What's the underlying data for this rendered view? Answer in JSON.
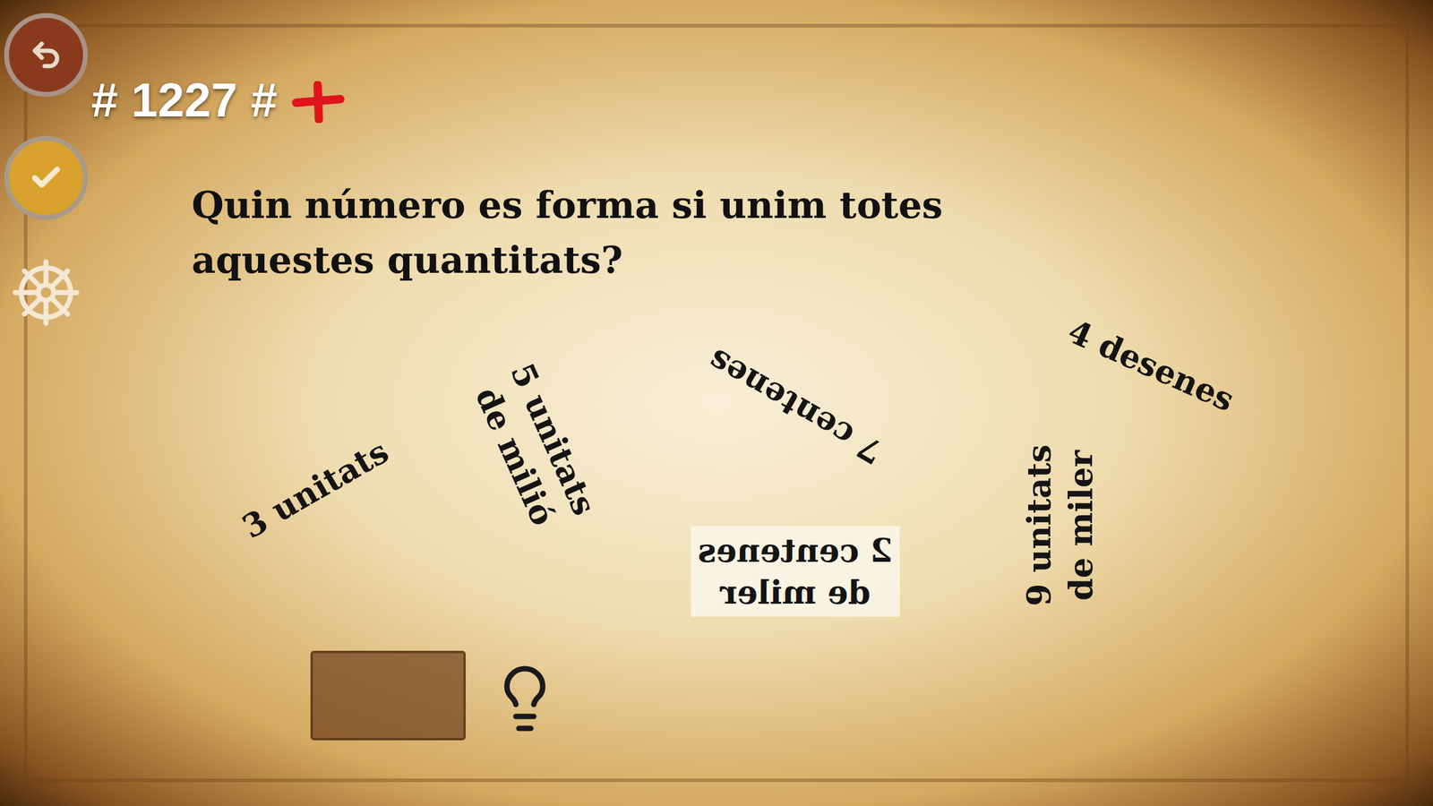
{
  "level_label": "# 1227 #",
  "question": {
    "lines": [
      "Quin número es forma si unim totes",
      "aquestes quantitats?"
    ]
  },
  "quantities": [
    {
      "lines": [
        "3 unitats"
      ],
      "highlighted": false
    },
    {
      "lines": [
        "5 unitats",
        "de milió"
      ],
      "highlighted": false
    },
    {
      "lines": [
        "7 centenes"
      ],
      "highlighted": false
    },
    {
      "lines": [
        "2 centenes",
        "de miler"
      ],
      "highlighted": true
    },
    {
      "lines": [
        "9 unitats",
        "de miler"
      ],
      "highlighted": false
    },
    {
      "lines": [
        "4 desenes"
      ],
      "highlighted": false
    }
  ]
}
